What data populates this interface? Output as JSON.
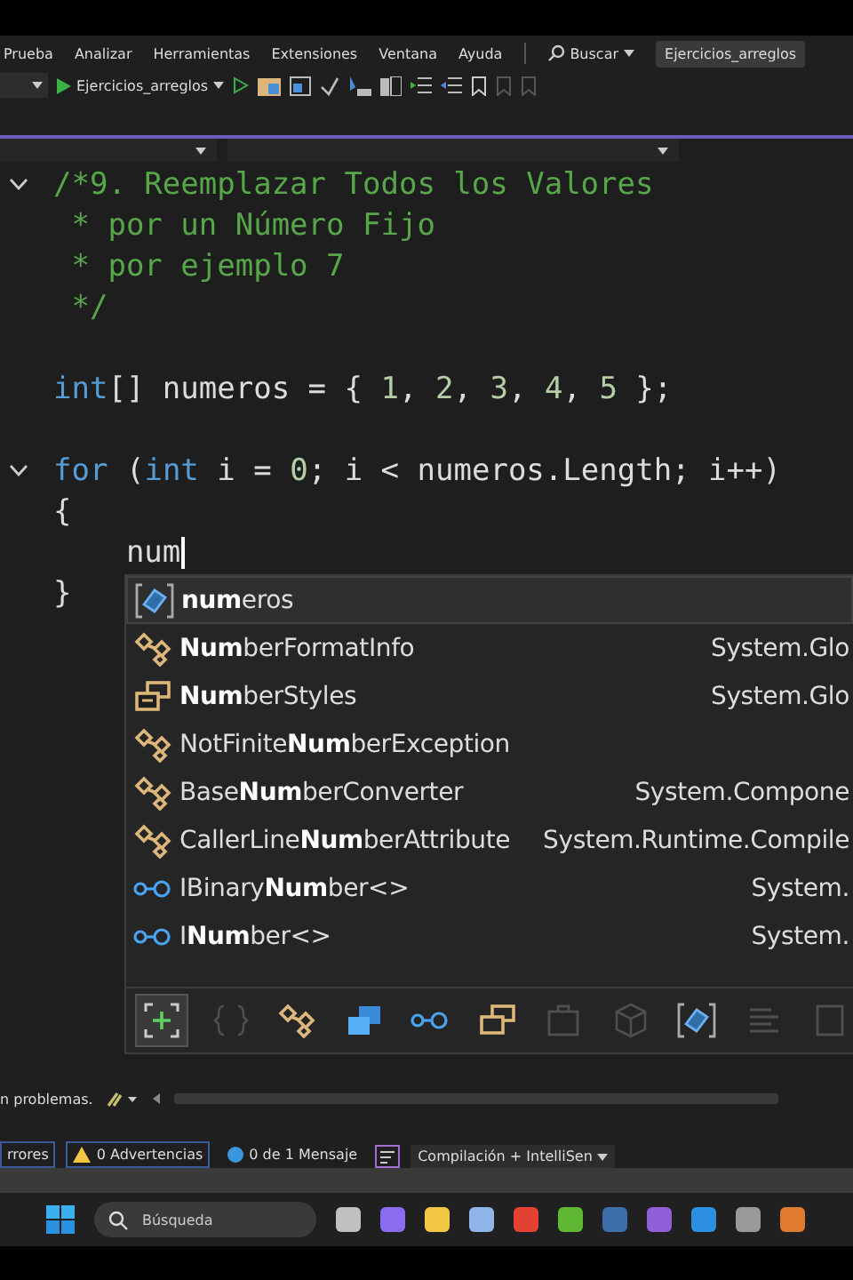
{
  "menu": {
    "items": [
      "Prueba",
      "Analizar",
      "Herramientas",
      "Extensiones",
      "Ventana",
      "Ayuda"
    ],
    "search": "Buscar",
    "solution": "Ejercicios_arreglos"
  },
  "toolbar": {
    "run_target": "Ejercicios_arreglos"
  },
  "code": [
    {
      "kind": "code",
      "fold": true,
      "cursor": false,
      "tokens": [
        {
          "kind": "comment",
          "text": "/*9. Reemplazar Todos los Valores"
        }
      ]
    },
    {
      "kind": "code",
      "fold": false,
      "cursor": false,
      "tokens": [
        {
          "kind": "comment",
          "text": " * por un Número Fijo"
        }
      ]
    },
    {
      "kind": "code",
      "fold": false,
      "cursor": false,
      "tokens": [
        {
          "kind": "comment",
          "text": " * por ejemplo 7"
        }
      ]
    },
    {
      "kind": "code",
      "fold": false,
      "cursor": false,
      "tokens": [
        {
          "kind": "comment",
          "text": " */"
        }
      ]
    },
    {
      "kind": "blank"
    },
    {
      "kind": "code",
      "fold": false,
      "cursor": false,
      "tokens": [
        {
          "kind": "keyword",
          "text": "int"
        },
        {
          "kind": "plain",
          "text": "[] numeros = { "
        },
        {
          "kind": "number",
          "text": "1"
        },
        {
          "kind": "plain",
          "text": ", "
        },
        {
          "kind": "number",
          "text": "2"
        },
        {
          "kind": "plain",
          "text": ", "
        },
        {
          "kind": "number",
          "text": "3"
        },
        {
          "kind": "plain",
          "text": ", "
        },
        {
          "kind": "number",
          "text": "4"
        },
        {
          "kind": "plain",
          "text": ", "
        },
        {
          "kind": "number",
          "text": "5"
        },
        {
          "kind": "plain",
          "text": " };"
        }
      ]
    },
    {
      "kind": "blank"
    },
    {
      "kind": "code",
      "fold": true,
      "cursor": false,
      "tokens": [
        {
          "kind": "keyword",
          "text": "for"
        },
        {
          "kind": "plain",
          "text": " ("
        },
        {
          "kind": "keyword",
          "text": "int"
        },
        {
          "kind": "plain",
          "text": " i = "
        },
        {
          "kind": "number",
          "text": "0"
        },
        {
          "kind": "plain",
          "text": "; i < numeros.Length; i++)"
        }
      ]
    },
    {
      "kind": "code",
      "fold": false,
      "cursor": false,
      "tokens": [
        {
          "kind": "plain",
          "text": "{"
        }
      ]
    },
    {
      "kind": "code",
      "fold": false,
      "cursor": true,
      "tokens": [
        {
          "kind": "plain",
          "text": "    num"
        }
      ]
    },
    {
      "kind": "code",
      "fold": false,
      "cursor": false,
      "tokens": [
        {
          "kind": "plain",
          "text": "}"
        }
      ]
    }
  ],
  "completion": {
    "items": [
      {
        "kind": "local",
        "selected": true,
        "match": "num",
        "suffix": "eros"
      },
      {
        "kind": "class",
        "selected": false,
        "match": "Num",
        "suffix": "berFormatInfo",
        "namespace": "System.Glo"
      },
      {
        "kind": "enum",
        "selected": false,
        "match": "Num",
        "suffix": "berStyles",
        "namespace": "System.Glo"
      },
      {
        "kind": "class",
        "selected": false,
        "prefix": "NotFinite",
        "match": "Num",
        "suffix": "berException"
      },
      {
        "kind": "class",
        "selected": false,
        "prefix": "Base",
        "match": "Num",
        "suffix": "berConverter",
        "namespace": "System.Compone"
      },
      {
        "kind": "class",
        "selected": false,
        "prefix": "CallerLine",
        "match": "Num",
        "suffix": "berAttribute",
        "namespace": "System.Runtime.Compile"
      },
      {
        "kind": "interface",
        "selected": false,
        "prefix": "IBinary",
        "match": "Num",
        "suffix": "ber<>",
        "namespace": "System."
      },
      {
        "kind": "interface",
        "selected": false,
        "prefix": "I",
        "match": "Num",
        "suffix": "ber<>",
        "namespace": "System."
      }
    ],
    "filters": [
      {
        "kind": "expand",
        "selected": true,
        "disabled": false
      },
      {
        "kind": "braces",
        "selected": false,
        "disabled": true
      },
      {
        "kind": "class",
        "selected": false,
        "disabled": false
      },
      {
        "kind": "struct",
        "selected": false,
        "disabled": false
      },
      {
        "kind": "interface",
        "selected": false,
        "disabled": false
      },
      {
        "kind": "enum",
        "selected": false,
        "disabled": false
      },
      {
        "kind": "module",
        "selected": false,
        "disabled": true
      },
      {
        "kind": "cube",
        "selected": false,
        "disabled": true
      },
      {
        "kind": "local",
        "selected": false,
        "disabled": false
      },
      {
        "kind": "lines",
        "selected": false,
        "disabled": true
      },
      {
        "kind": "square",
        "selected": false,
        "disabled": true
      }
    ]
  },
  "status": {
    "problems": "n problemas."
  },
  "error_list": {
    "errors": "rrores",
    "warnings": "0 Advertencias",
    "messages": "0 de 1 Mensaje",
    "scope": "Compilación + IntelliSen"
  },
  "taskbar": {
    "search": "Búsqueda",
    "apps": [
      {
        "color": "#c0c0c0"
      },
      {
        "color": "#8a6cf0"
      },
      {
        "color": "#f2c744"
      },
      {
        "color": "#8fb4e8"
      },
      {
        "color": "#e34133"
      },
      {
        "color": "#5fb832"
      },
      {
        "color": "#3b6da8"
      },
      {
        "color": "#8e5fd6"
      },
      {
        "color": "#2d8fe0"
      },
      {
        "color": "#9a9a9a"
      },
      {
        "color": "#e07a2f"
      }
    ]
  }
}
